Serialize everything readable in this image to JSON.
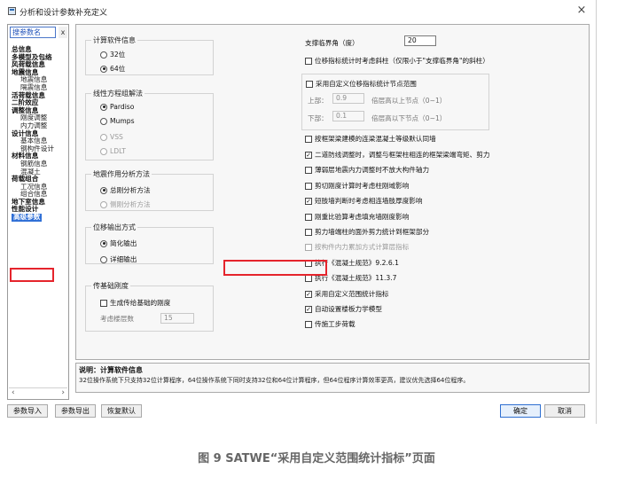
{
  "window": {
    "title": "分析和设计参数补充定义",
    "close": "×"
  },
  "left": {
    "search_text": "搜参数名",
    "search_clear": "x",
    "nav": [
      {
        "label": "总信息",
        "level": 0
      },
      {
        "label": "多模型及包络",
        "level": 0
      },
      {
        "label": "风荷载信息",
        "level": 0
      },
      {
        "label": "地震信息",
        "level": 0
      },
      {
        "label": "地震信息",
        "level": 1
      },
      {
        "label": "隔震信息",
        "level": 1
      },
      {
        "label": "活荷载信息",
        "level": 0
      },
      {
        "label": "二阶效应",
        "level": 0
      },
      {
        "label": "调整信息",
        "level": 0
      },
      {
        "label": "刚度调整",
        "level": 1
      },
      {
        "label": "内力调整",
        "level": 1
      },
      {
        "label": "设计信息",
        "level": 0
      },
      {
        "label": "基本信息",
        "level": 1
      },
      {
        "label": "钢构件设计",
        "level": 1
      },
      {
        "label": "材料信息",
        "level": 0
      },
      {
        "label": "钢筋信息",
        "level": 1
      },
      {
        "label": "混凝土",
        "level": 1
      },
      {
        "label": "荷载组合",
        "level": 0
      },
      {
        "label": "工况信息",
        "level": 1
      },
      {
        "label": "组合信息",
        "level": 1
      },
      {
        "label": "地下室信息",
        "level": 0
      },
      {
        "label": "性能设计",
        "level": 0
      },
      {
        "label": "高级参数",
        "level": 0,
        "selected": true
      }
    ],
    "scroll_left": "‹",
    "scroll_right": "›"
  },
  "main": {
    "calc_group": {
      "title": "计算软件信息",
      "opt1": "32位",
      "opt2": "64位",
      "selected": "64位"
    },
    "solver_group": {
      "title": "线性方程组解法",
      "opt1": "Pardiso",
      "opt2": "Mumps",
      "opt3": "VSS",
      "opt4": "LDLT",
      "selected": "Pardiso"
    },
    "seismic_group": {
      "title": "地震作用分析方法",
      "opt1": "总刚分析方法",
      "opt2": "侧刚分析方法",
      "selected": "总刚分析方法"
    },
    "output_group": {
      "title": "位移输出方式",
      "opt1": "简化输出",
      "opt2": "详细输出",
      "selected": "简化输出"
    },
    "base_group": {
      "title": "传基础刚度",
      "check_label": "生成传给基础的刚度",
      "floors_label": "考虑楼层数",
      "floors_value": "15"
    },
    "support_angle": {
      "label": "支撑临界角（度）",
      "value": "20"
    },
    "disp_check": "位移指标统计时考虑斜柱（仅限小于\"支撑临界角\"的斜柱）",
    "custom_range": {
      "check_label": "采用自定义位移指标统计节点范围",
      "upper_label": "上部：",
      "upper_value": "0.9",
      "upper_note": "倍层高以上节点（0~1）",
      "lower_label": "下部：",
      "lower_value": "0.1",
      "lower_note": "倍层高以下节点（0~1）"
    },
    "checks": [
      {
        "label": "按框架梁建模的连梁混凝土等级默认同墙",
        "checked": false,
        "disabled": false
      },
      {
        "label": "二道防线调整时，调整与框架柱相连的框架梁端弯矩、剪力",
        "checked": true,
        "disabled": false
      },
      {
        "label": "薄弱层地震内力调整时不放大构件轴力",
        "checked": false,
        "disabled": false
      },
      {
        "label": "剪切刚度计算时考虑柱刚域影响",
        "checked": false,
        "disabled": false
      },
      {
        "label": "短肢墙判断时考虑相连墙肢厚度影响",
        "checked": true,
        "disabled": false
      },
      {
        "label": "刚重比验算考虑填充墙刚度影响",
        "checked": false,
        "disabled": false
      },
      {
        "label": "剪力墙端柱的面外剪力统计到框架部分",
        "checked": false,
        "disabled": false
      },
      {
        "label": "按构件内力累加方式计算层指标",
        "checked": false,
        "disabled": true
      },
      {
        "label": "执行《混凝土规范》9.2.6.1",
        "checked": false,
        "disabled": false
      },
      {
        "label": "执行《混凝土规范》11.3.7",
        "checked": false,
        "disabled": false
      },
      {
        "label": "采用自定义范围统计指标",
        "checked": true,
        "disabled": false
      },
      {
        "label": "自动设置楼板力学模型",
        "checked": true,
        "disabled": false
      },
      {
        "label": "传施工步荷载",
        "checked": false,
        "disabled": false
      }
    ]
  },
  "description": {
    "title": "说明：计算软件信息",
    "text": "32位操作系统下只支持32位计算程序，64位操作系统下同时支持32位和64位计算程序，但64位程序计算效率更高，建议优先选择64位程序。"
  },
  "buttons": {
    "import": "参数导入",
    "export": "参数导出",
    "restore": "恢复默认",
    "ok": "确定",
    "cancel": "取消"
  },
  "caption": "图 9 SATWE“采用自定义范围统计指标”页面",
  "colors": {
    "highlight": "#e5242c",
    "selection": "#2f6fd6"
  }
}
